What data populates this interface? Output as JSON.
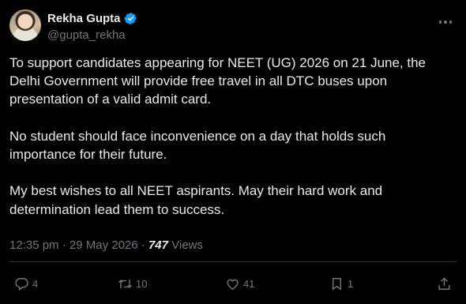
{
  "author": {
    "display_name": "Rekha Gupta",
    "handle": "@gupta_rekha",
    "verified": true
  },
  "tweet": {
    "paragraphs": [
      "To support candidates appearing for NEET (UG) 2026 on 21 June, the Delhi Government will provide free travel in all DTC buses upon presentation of a valid admit card.",
      "No student should face inconvenience on a day that holds such importance for their future.",
      "My best wishes to all NEET aspirants. May their hard work and determination lead them to success."
    ],
    "time": "12:35 pm",
    "separator": "·",
    "date": "29 May 2026",
    "views_count": "747",
    "views_label": "Views"
  },
  "actions": {
    "replies": "4",
    "reposts": "10",
    "likes": "41",
    "bookmarks": "1"
  },
  "colors": {
    "background": "#000000",
    "text": "#e7e9ea",
    "muted": "#71767b",
    "verified_badge": "#1d9bf0",
    "divider": "#2f3336"
  }
}
